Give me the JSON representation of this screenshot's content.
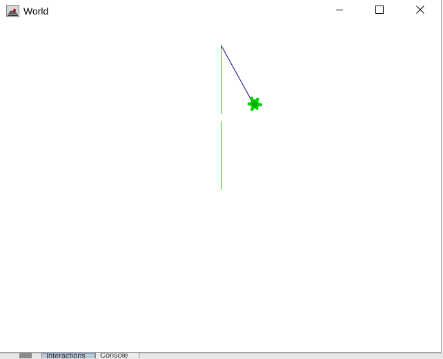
{
  "window": {
    "title": "World",
    "app_icon": "java-cup-icon",
    "controls": {
      "minimize_icon": "minimize-icon",
      "maximize_icon": "maximize-icon",
      "close_icon": "close-icon"
    }
  },
  "world": {
    "background": "#ffffff",
    "pen_colors": {
      "primary": "#00cc00",
      "secondary": "#00008b"
    },
    "turtle": {
      "icon": "turtle-icon",
      "color": "#00cc00"
    }
  },
  "background_app": {
    "tabs": [
      {
        "label": "Interactions",
        "active": true
      },
      {
        "label": "Console",
        "active": false
      }
    ]
  }
}
